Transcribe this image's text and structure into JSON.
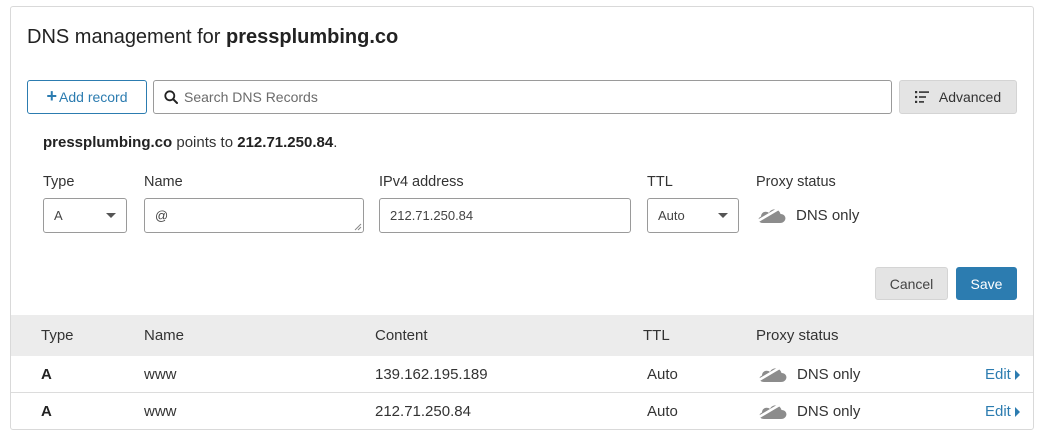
{
  "header": {
    "title_prefix": "DNS management for",
    "domain": "pressplumbing.co"
  },
  "toolbar": {
    "add_record_label": "Add record",
    "search_placeholder": "Search DNS Records",
    "advanced_label": "Advanced"
  },
  "points_to": {
    "domain": "pressplumbing.co",
    "text": "points to",
    "ip": "212.71.250.84",
    "period": "."
  },
  "form": {
    "type_label": "Type",
    "type_value": "A",
    "name_label": "Name",
    "name_value": "@",
    "ipv4_label": "IPv4 address",
    "ipv4_value": "212.71.250.84",
    "ttl_label": "TTL",
    "ttl_value": "Auto",
    "proxy_label": "Proxy status",
    "proxy_value": "DNS only",
    "cancel_label": "Cancel",
    "save_label": "Save"
  },
  "table": {
    "headers": [
      "Type",
      "Name",
      "Content",
      "TTL",
      "Proxy status"
    ],
    "rows": [
      {
        "type": "A",
        "name": "www",
        "content": "139.162.195.189",
        "ttl": "Auto",
        "proxy": "DNS only",
        "action": "Edit"
      },
      {
        "type": "A",
        "name": "www",
        "content": "212.71.250.84",
        "ttl": "Auto",
        "proxy": "DNS only",
        "action": "Edit"
      }
    ]
  },
  "icons": {
    "search": "search-icon",
    "plus": "plus-icon",
    "advanced": "filter-list-icon",
    "cloud": "cloud-off-icon",
    "caret": "chevron-down-icon",
    "edit_caret": "chevron-right-icon"
  },
  "colors": {
    "accent": "#2c7cb0",
    "header_bg": "#ececec",
    "button_gray": "#e4e4e4",
    "border": "#9a9a9a"
  }
}
